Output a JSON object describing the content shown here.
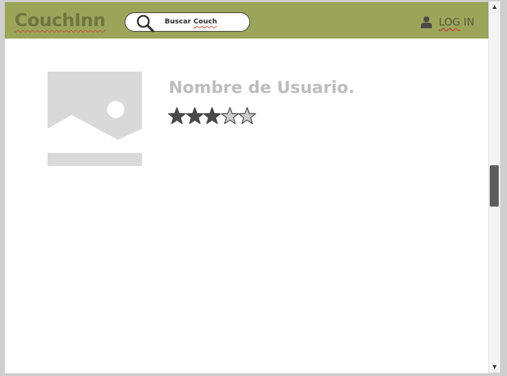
{
  "header": {
    "logo": "CouchInn",
    "search": {
      "placeholder_prefix": "Buscar ",
      "placeholder_word": "Couch"
    },
    "login": {
      "prefix": "LOG",
      "suffix": " IN"
    }
  },
  "profile": {
    "username": "Nombre de Usuario.",
    "rating": {
      "value": 3,
      "max": 5
    }
  },
  "scrollbar": {
    "up_glyph": "▲",
    "down_glyph": "▼"
  },
  "colors": {
    "header_bg": "#9aa55a",
    "logo": "#6f7540",
    "username": "#bdbdbd",
    "star_filled": "#4a4a4a",
    "star_empty": "#cccccc"
  },
  "icons": [
    "search-icon",
    "user-icon",
    "image-placeholder-icon",
    "star-icon"
  ]
}
